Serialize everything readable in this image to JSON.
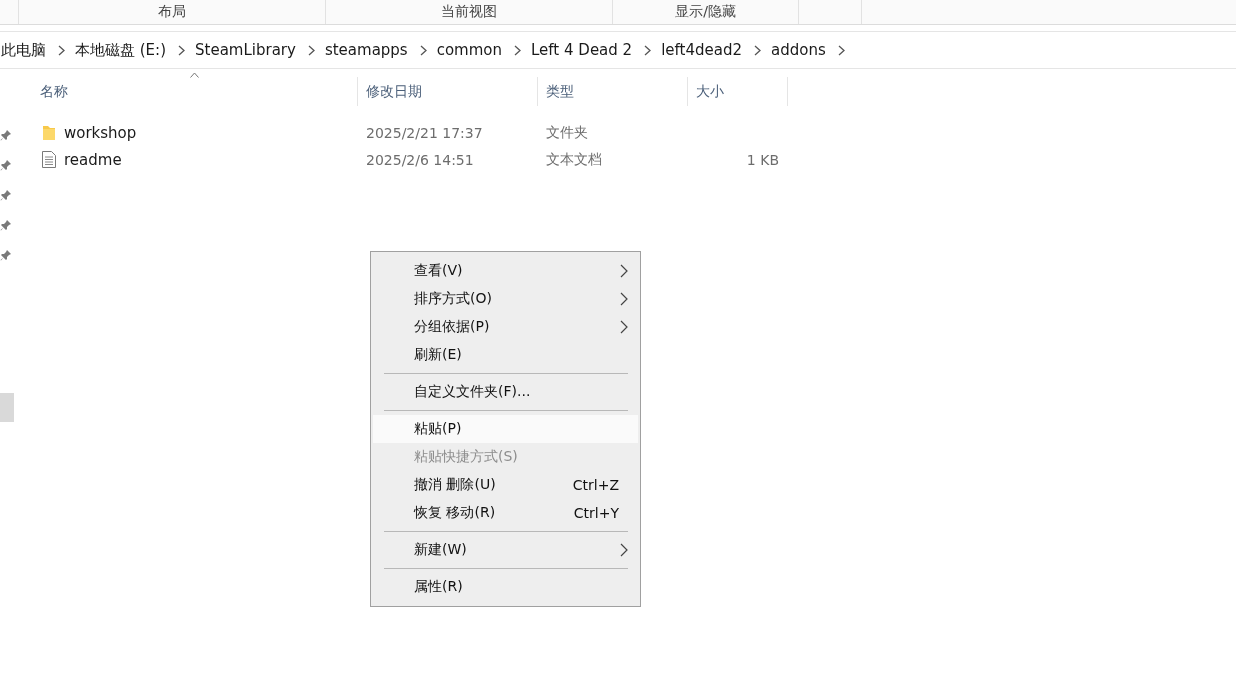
{
  "ribbon": {
    "groups": [
      "布局",
      "当前视图",
      "显示/隐藏"
    ]
  },
  "breadcrumb": [
    "此电脑",
    "本地磁盘 (E:)",
    "SteamLibrary",
    "steamapps",
    "common",
    "Left 4 Dead 2",
    "left4dead2",
    "addons"
  ],
  "table": {
    "columns": [
      "名称",
      "修改日期",
      "类型",
      "大小"
    ],
    "rows": [
      {
        "kind": "folder",
        "name": "workshop",
        "date": "2025/2/21 17:37",
        "type": "文件夹",
        "size": ""
      },
      {
        "kind": "text",
        "name": "readme",
        "date": "2025/2/6 14:51",
        "type": "文本文档",
        "size": "1 KB"
      }
    ]
  },
  "context_menu": {
    "items": [
      {
        "kind": "item",
        "label": "查看(V)",
        "submenu": true,
        "disabled": false,
        "selected": false
      },
      {
        "kind": "item",
        "label": "排序方式(O)",
        "submenu": true,
        "disabled": false,
        "selected": false
      },
      {
        "kind": "item",
        "label": "分组依据(P)",
        "submenu": true,
        "disabled": false,
        "selected": false
      },
      {
        "kind": "item",
        "label": "刷新(E)",
        "submenu": false,
        "disabled": false,
        "selected": false
      },
      {
        "kind": "separator"
      },
      {
        "kind": "item",
        "label": "自定义文件夹(F)...",
        "submenu": false,
        "disabled": false,
        "selected": false
      },
      {
        "kind": "separator"
      },
      {
        "kind": "item",
        "label": "粘贴(P)",
        "submenu": false,
        "disabled": false,
        "selected": true
      },
      {
        "kind": "item",
        "label": "粘贴快捷方式(S)",
        "submenu": false,
        "disabled": true,
        "selected": false
      },
      {
        "kind": "item",
        "label": "撤消 删除(U)",
        "shortcut": "Ctrl+Z",
        "submenu": false,
        "disabled": false,
        "selected": false
      },
      {
        "kind": "item",
        "label": "恢复 移动(R)",
        "shortcut": "Ctrl+Y",
        "submenu": false,
        "disabled": false,
        "selected": false
      },
      {
        "kind": "separator"
      },
      {
        "kind": "item",
        "label": "新建(W)",
        "submenu": true,
        "disabled": false,
        "selected": false
      },
      {
        "kind": "separator"
      },
      {
        "kind": "item",
        "label": "属性(R)",
        "submenu": false,
        "disabled": false,
        "selected": false
      }
    ]
  }
}
